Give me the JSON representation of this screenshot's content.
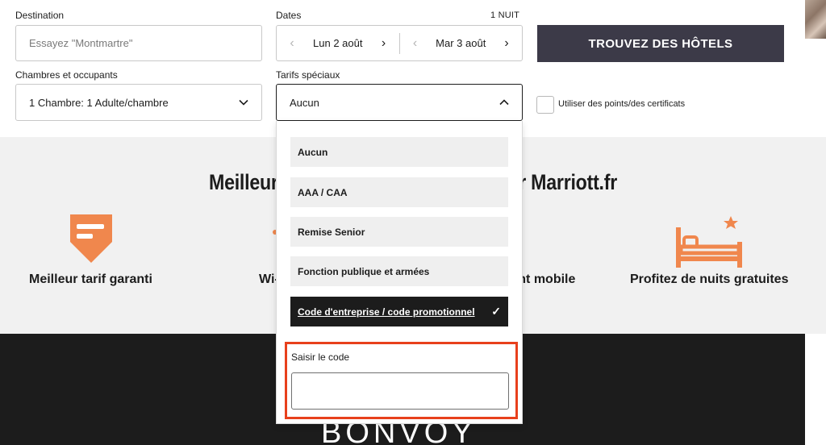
{
  "search": {
    "destination_label": "Destination",
    "destination_placeholder": "Essayez \"Montmartre\"",
    "dates_label": "Dates",
    "nights": "1 NUIT",
    "checkin": "Lun 2 août",
    "checkout": "Mar 3 août",
    "find_button": "TROUVEZ DES HÔTELS",
    "rooms_label": "Chambres et occupants",
    "rooms_value": "1 Chambre: 1 Adulte/chambre",
    "rates_label": "Tarifs spéciaux",
    "rates_value": "Aucun",
    "points_label": "Utiliser des points/des certificats"
  },
  "band": {
    "title": "Meilleur tarif garanti uniquement sur Marriott.fr",
    "features": [
      {
        "label": "Meilleur tarif garanti",
        "icon": "price-tag-icon"
      },
      {
        "label": "Wi-Fi gratuit",
        "icon": "wifi-icon"
      },
      {
        "label": "Enregistrement mobile",
        "icon": "mobile-checkin-icon"
      },
      {
        "label": "Profitez de nuits gratuites",
        "icon": "bed-star-icon"
      }
    ],
    "accent_color": "#f0874d"
  },
  "footer": {
    "brand": "BONVOY"
  },
  "rates_dropdown": {
    "options": [
      "Aucun",
      "AAA / CAA",
      "Remise Senior",
      "Fonction publique et armées",
      "Code d'entreprise / code promotionnel"
    ],
    "selected_index": 4,
    "code_label": "Saisir le code",
    "highlight_color": "#e8401c"
  }
}
